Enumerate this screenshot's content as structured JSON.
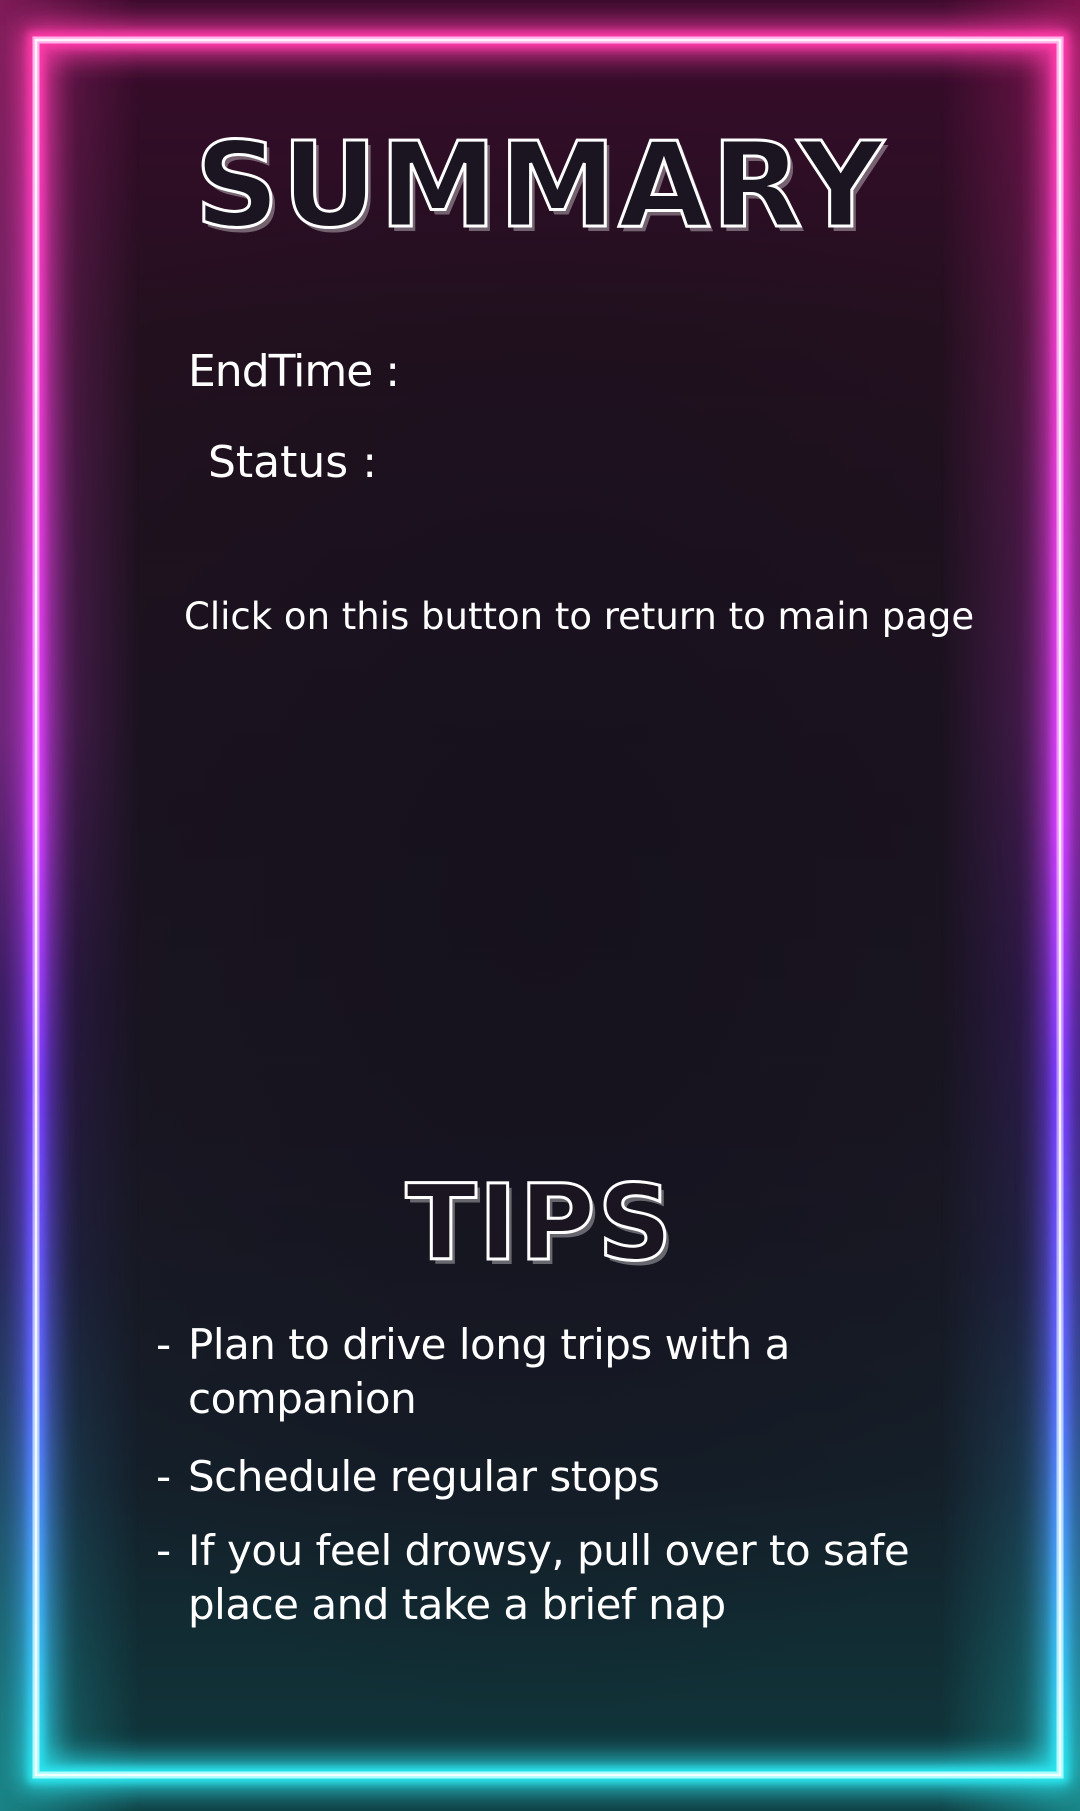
{
  "summary": {
    "title": "SUMMARY",
    "end_time_label": "EndTime :",
    "status_label": "Status :",
    "return_text": "Click on this button to return to main page"
  },
  "tips": {
    "title": "TIPS",
    "items": [
      "Plan to drive long trips with a companion",
      "Schedule regular stops",
      "If you feel drowsy, pull over to safe place and take a brief nap"
    ]
  },
  "colors": {
    "frame_top": "#ff8fe0",
    "frame_mid": "#e27cff",
    "frame_bottom": "#8ffcff",
    "text": "#ffffff"
  }
}
